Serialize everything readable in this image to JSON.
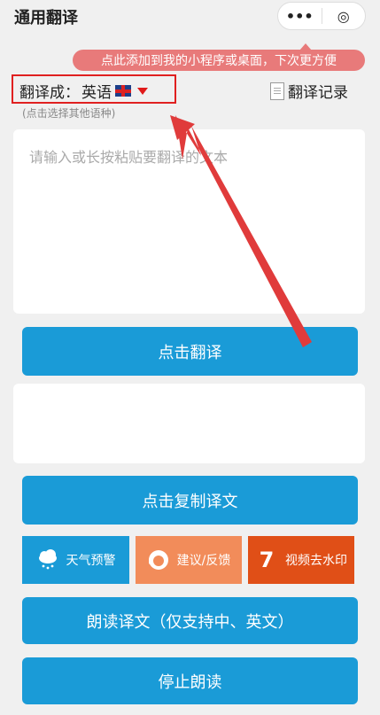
{
  "app": {
    "title": "通用翻译"
  },
  "capsule": {
    "more": "•••",
    "close": "◎"
  },
  "tip": {
    "text": "点此添加到我的小程序或桌面，下次更方便"
  },
  "translate_to": {
    "label": "翻译成：",
    "language": "英语"
  },
  "hint": "(点击选择其他语种)",
  "history": {
    "label": "翻译记录"
  },
  "input": {
    "placeholder": "请输入或长按粘贴要翻译的文本",
    "value": ""
  },
  "buttons": {
    "translate": "点击翻译",
    "copy": "点击复制译文",
    "read": "朗读译文（仅支持中、英文）",
    "stop": "停止朗读"
  },
  "tiles": [
    {
      "label": "天气预警",
      "icon": "cloud-rain-icon",
      "color": "#1a9bd7"
    },
    {
      "label": "建议/反馈",
      "icon": "support-agent-icon",
      "color": "#f28c5a"
    },
    {
      "label": "视频去水印",
      "icon": "number-seven-icon",
      "color": "#e04f17"
    }
  ],
  "colors": {
    "primary": "#1a9bd7",
    "tip": "#e87a7a",
    "annotation": "#e02020"
  }
}
